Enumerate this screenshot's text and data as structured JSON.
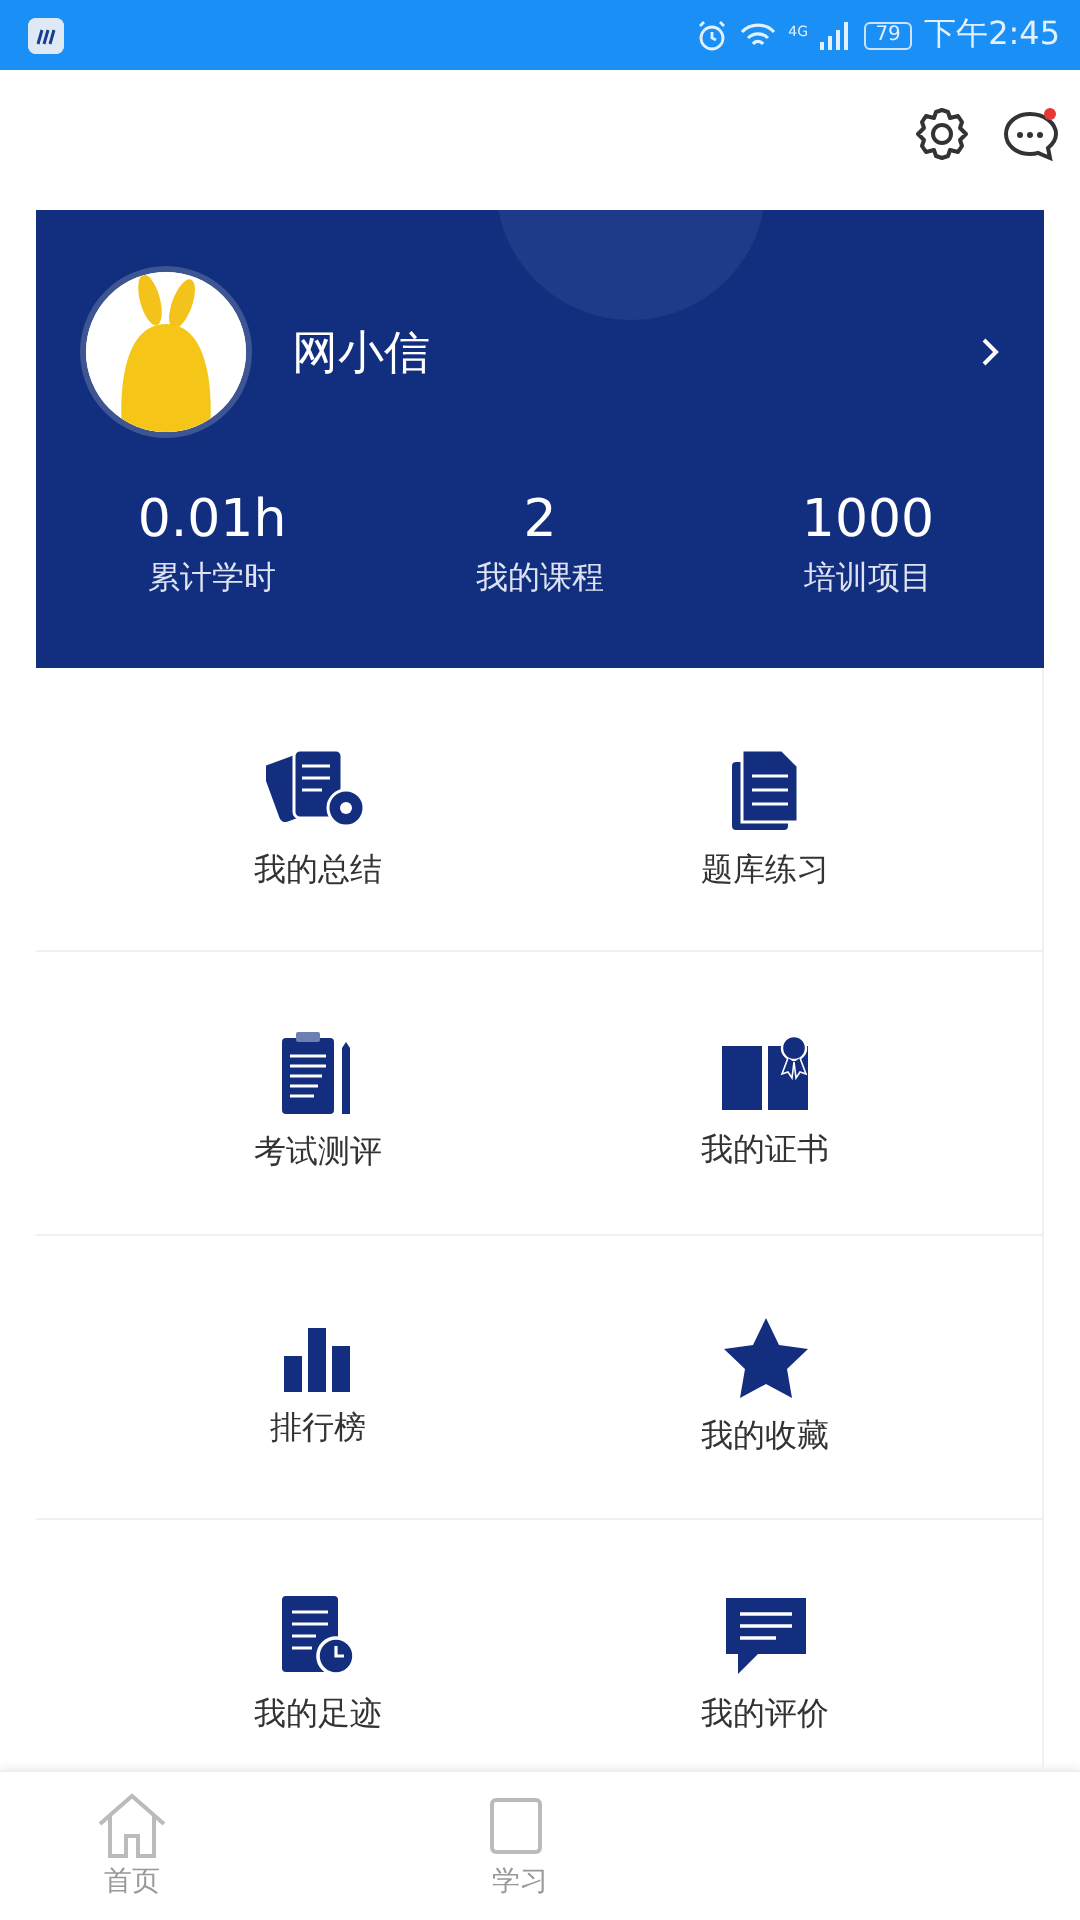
{
  "status_bar": {
    "time": "下午2:45",
    "network": "4G",
    "battery": "79"
  },
  "header": {
    "has_unread": true
  },
  "profile": {
    "name": "网小信",
    "stats": [
      {
        "value": "0.01h",
        "label": "累计学时"
      },
      {
        "value": "2",
        "label": "我的课程"
      },
      {
        "value": "1000",
        "label": "培训项目"
      }
    ]
  },
  "menu": [
    {
      "label": "我的总结"
    },
    {
      "label": "题库练习"
    },
    {
      "label": "考试测评"
    },
    {
      "label": "我的证书"
    },
    {
      "label": "排行榜"
    },
    {
      "label": "我的收藏"
    },
    {
      "label": "我的足迹"
    },
    {
      "label": "我的评价"
    }
  ],
  "bottom_nav": [
    {
      "label": "首页",
      "selected": false
    },
    {
      "label": "学习",
      "selected": false
    }
  ]
}
